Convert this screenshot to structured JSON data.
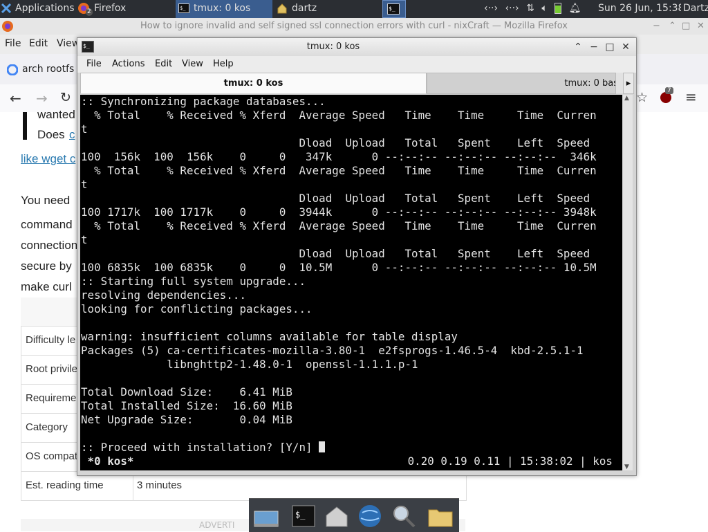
{
  "panel": {
    "apps_label": "Applications",
    "apps_suffix": "≡",
    "tasks": [
      {
        "label": "Firefox",
        "badge": "2"
      },
      {
        "label": "tmux: 0 kos"
      },
      {
        "label": "dartz"
      },
      {
        "label": ""
      }
    ],
    "datetime": "Sun 26 Jun, 15:38",
    "user": "Dartz"
  },
  "firefox": {
    "title": "How to ignore invalid and self signed ssl connection errors with curl - nixCraft — Mozilla Firefox",
    "menu": [
      "File",
      "Edit",
      "View"
    ],
    "tab_label": "arch rootfs",
    "ext_badge": "7",
    "content": {
      "line1": "wanted",
      "line2": "Does",
      "line2_link": "c",
      "link_line": "like wget c",
      "para": [
        "You need",
        "command",
        "connection",
        "secure by",
        "make curl"
      ],
      "table_rows": [
        {
          "k": "",
          "v": ""
        },
        {
          "k": "Difficulty le",
          "v": ""
        },
        {
          "k": "Root privile",
          "v": ""
        },
        {
          "k": "Requireme",
          "v": ""
        },
        {
          "k": "Category",
          "v": ""
        },
        {
          "k": "OS compat",
          "v": ""
        },
        {
          "k": "Est. reading time",
          "v": "3 minutes"
        }
      ],
      "advert": "ADVERTI"
    }
  },
  "terminal": {
    "title": "tmux: 0 kos",
    "menu": [
      "File",
      "Actions",
      "Edit",
      "View",
      "Help"
    ],
    "tabs": [
      "tmux: 0 kos",
      "tmux: 0 bas"
    ],
    "lines": [
      ":: Synchronizing package databases...",
      "  % Total    % Received % Xferd  Average Speed   Time    Time     Time  Curren",
      "t",
      "                                 Dload  Upload   Total   Spent    Left  Speed",
      "100  156k  100  156k    0     0   347k      0 --:--:-- --:--:-- --:--:--  346k",
      "  % Total    % Received % Xferd  Average Speed   Time    Time     Time  Curren",
      "t",
      "                                 Dload  Upload   Total   Spent    Left  Speed",
      "100 1717k  100 1717k    0     0  3944k      0 --:--:-- --:--:-- --:--:-- 3948k",
      "  % Total    % Received % Xferd  Average Speed   Time    Time     Time  Curren",
      "t",
      "                                 Dload  Upload   Total   Spent    Left  Speed",
      "100 6835k  100 6835k    0     0  10.5M      0 --:--:-- --:--:-- --:--:-- 10.5M",
      ":: Starting full system upgrade...",
      "resolving dependencies...",
      "looking for conflicting packages...",
      "",
      "warning: insufficient columns available for table display",
      "Packages (5) ca-certificates-mozilla-3.80-1  e2fsprogs-1.46.5-4  kbd-2.5.1-1",
      "             libnghttp2-1.48.0-1  openssl-1.1.1.p-1",
      "",
      "Total Download Size:    6.41 MiB",
      "Total Installed Size:  16.60 MiB",
      "Net Upgrade Size:       0.04 MiB",
      "",
      ":: Proceed with installation? [Y/n] "
    ],
    "status_left": " *0 kos*",
    "status_right": "0.20 0.19 0.11 | 15:38:02 | kos"
  }
}
